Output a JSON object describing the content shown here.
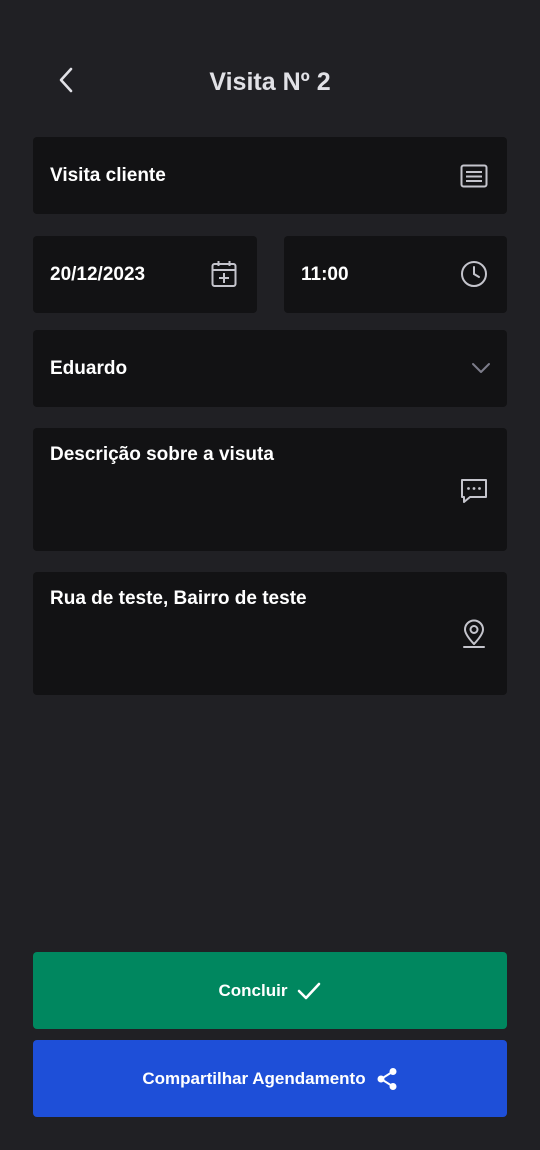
{
  "header": {
    "title": "Visita Nº 2",
    "back_icon": "chevron-left-icon"
  },
  "form": {
    "title_value": "Visita cliente",
    "title_icon": "list-lines-icon",
    "date_value": "20/12/2023",
    "date_icon": "calendar-plus-icon",
    "time_value": "11:00",
    "time_icon": "clock-icon",
    "client_value": "Eduardo",
    "client_icon": "chevron-down-icon",
    "description_value": "Descrição sobre a visuta",
    "description_icon": "chat-bubble-icon",
    "address_value": "Rua de teste, Bairro de teste",
    "address_icon": "map-pin-icon"
  },
  "actions": {
    "done_label": "Concluir",
    "done_icon": "check-icon",
    "share_label": "Compartilhar Agendamento",
    "share_icon": "share-icon"
  },
  "colors": {
    "background": "#202024",
    "field_background": "#121214",
    "done_button": "#00875f",
    "share_button": "#1e4fd8",
    "icon_color": "#c4c4cc"
  }
}
